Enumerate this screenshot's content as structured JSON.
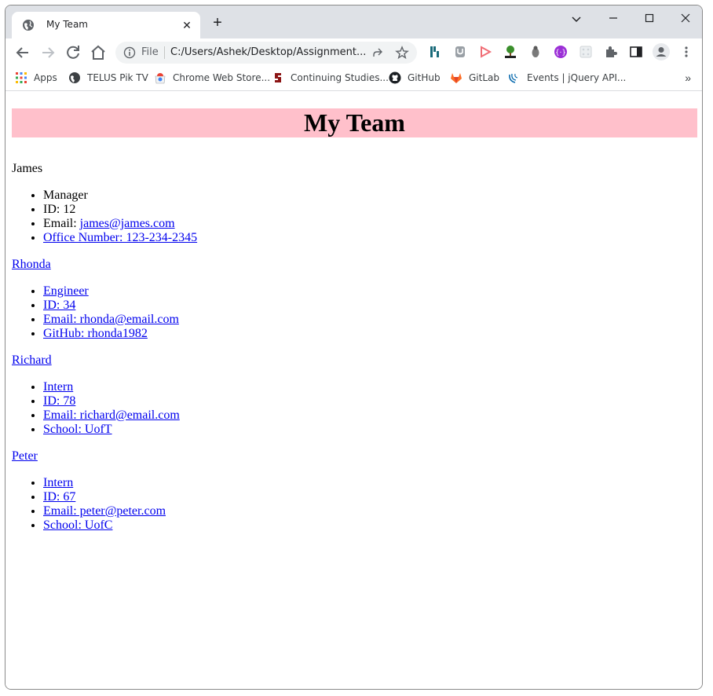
{
  "browser": {
    "tab_title": "My Team",
    "omnibox": {
      "scheme_label": "File",
      "url": "C:/Users/Ashek/Desktop/Assignment..."
    },
    "bookmarks": [
      {
        "label": "Apps",
        "icon": "apps-grid-icon"
      },
      {
        "label": "TELUS Pik TV",
        "icon": "globe-icon"
      },
      {
        "label": "Chrome Web Store...",
        "icon": "chrome-web-store-icon"
      },
      {
        "label": "Continuing Studies...",
        "icon": "stanford-icon"
      },
      {
        "label": "GitHub",
        "icon": "github-icon"
      },
      {
        "label": "GitLab",
        "icon": "gitlab-icon"
      },
      {
        "label": "Events | jQuery API...",
        "icon": "jquery-icon"
      }
    ],
    "bookmarks_more": "»"
  },
  "page": {
    "title": "My Team",
    "members": [
      {
        "name": "James",
        "name_is_link": false,
        "items": [
          {
            "text": "Manager",
            "link": false
          },
          {
            "text": "ID: 12",
            "link": false
          },
          {
            "prefix": "Email: ",
            "link_text": "james@james.com",
            "link": "partial"
          },
          {
            "text": "Office Number: 123-234-2345",
            "link": true
          }
        ]
      },
      {
        "name": "Rhonda",
        "name_is_link": true,
        "items": [
          {
            "text": "Engineer",
            "link": true
          },
          {
            "text": "ID: 34",
            "link": true
          },
          {
            "text": "Email: rhonda@email.com",
            "link": true
          },
          {
            "text": "GitHub: rhonda1982",
            "link": true
          }
        ]
      },
      {
        "name": "Richard",
        "name_is_link": true,
        "items": [
          {
            "text": "Intern",
            "link": true
          },
          {
            "text": "ID: 78",
            "link": true
          },
          {
            "text": "Email: richard@email.com",
            "link": true
          },
          {
            "text": "School: UofT",
            "link": true
          }
        ]
      },
      {
        "name": "Peter",
        "name_is_link": true,
        "items": [
          {
            "text": "Intern",
            "link": true
          },
          {
            "text": "ID: 67",
            "link": true
          },
          {
            "text": "Email: peter@peter.com",
            "link": true
          },
          {
            "text": "School: UofC",
            "link": true
          }
        ]
      }
    ]
  }
}
